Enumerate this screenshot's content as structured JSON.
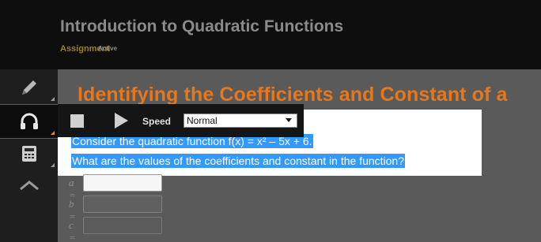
{
  "header": {
    "title": "Introduction to Quadratic Functions",
    "assignment_label": "Assignment",
    "status_label": "Active"
  },
  "rail": {
    "items": [
      {
        "icon": "pencil-icon"
      },
      {
        "icon": "headphones-icon",
        "active": true
      },
      {
        "icon": "calculator-icon"
      },
      {
        "icon": "chevron-up-icon"
      }
    ]
  },
  "content": {
    "title": "Identifying the Coefficients and Constant of a ",
    "question_line1": "Consider the quadratic function f(x) = x² – 5x + 6.",
    "question_line2": "What are the values of the coefficients and constant in the function?",
    "fields": [
      {
        "label": "a =",
        "value": ""
      },
      {
        "label": "b =",
        "value": ""
      },
      {
        "label": "c =",
        "value": ""
      }
    ]
  },
  "audio": {
    "speed_label": "Speed",
    "speed_value": "Normal"
  },
  "colors": {
    "title_orange": "#e6781b",
    "selection_blue": "#3399ff",
    "active_accent": "#e08b2a"
  }
}
